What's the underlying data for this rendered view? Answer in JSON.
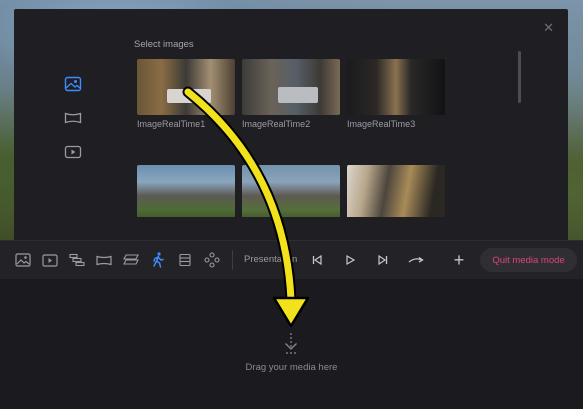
{
  "modal": {
    "close_glyph": "✕",
    "section_title": "Select images",
    "side_tabs": [
      {
        "icon": "image-icon",
        "active": true
      },
      {
        "icon": "panorama-icon",
        "active": false
      },
      {
        "icon": "video-icon",
        "active": false
      }
    ],
    "thumbnails": [
      {
        "label": "ImageRealTime1"
      },
      {
        "label": "ImageRealTime2"
      },
      {
        "label": "ImageRealTime3"
      },
      {
        "label": ""
      },
      {
        "label": ""
      },
      {
        "label": ""
      }
    ]
  },
  "toolbar": {
    "tools": [
      "image-icon",
      "video-icon",
      "timeline-icon",
      "panorama-icon",
      "layers-icon",
      "walk-person-icon",
      "list-icon",
      "nodes-icon"
    ],
    "active_tool": "walk-person-icon",
    "presentation_label": "Presentation",
    "playback": [
      "skip-back-icon",
      "play-icon",
      "skip-forward-icon",
      "transition-icon"
    ],
    "add_glyph": "+",
    "quit_label": "Quit media mode"
  },
  "dropzone": {
    "icon": "drop-arrow-icon",
    "text": "Drag your media here"
  },
  "colors": {
    "accent_blue": "#3d8bff",
    "quit_pink": "#e0457b",
    "annotation_yellow": "#f2e21b"
  }
}
